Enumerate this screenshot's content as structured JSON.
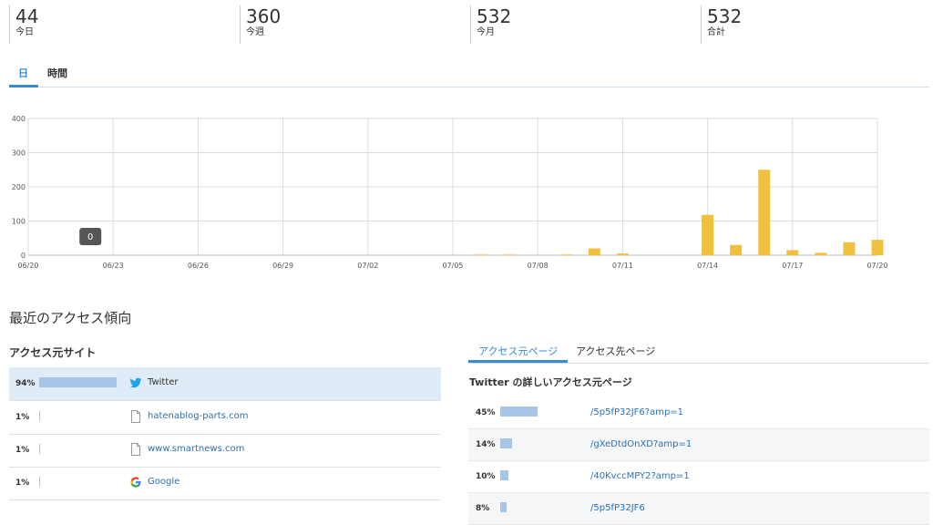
{
  "summary": [
    {
      "value": "44",
      "label": "今日"
    },
    {
      "value": "360",
      "label": "今週"
    },
    {
      "value": "532",
      "label": "今月"
    },
    {
      "value": "532",
      "label": "合計"
    }
  ],
  "view_tabs": [
    {
      "label": "日",
      "active": true
    },
    {
      "label": "時間",
      "active": false
    }
  ],
  "chart_data": {
    "type": "bar",
    "categories": [
      "06/20",
      "06/21",
      "06/22",
      "06/23",
      "06/24",
      "06/25",
      "06/26",
      "06/27",
      "06/28",
      "06/29",
      "06/30",
      "07/01",
      "07/02",
      "07/03",
      "07/04",
      "07/05",
      "07/06",
      "07/07",
      "07/08",
      "07/09",
      "07/10",
      "07/11",
      "07/12",
      "07/13",
      "07/14",
      "07/15",
      "07/16",
      "07/17",
      "07/18",
      "07/19",
      "07/20"
    ],
    "values": [
      0,
      0,
      0,
      0,
      0,
      0,
      0,
      0,
      0,
      0,
      0,
      0,
      0,
      0,
      0,
      0,
      2,
      2,
      0,
      2,
      20,
      5,
      0,
      0,
      118,
      30,
      250,
      15,
      7,
      38,
      45
    ],
    "x_tick_labels": [
      "06/20",
      "06/23",
      "06/26",
      "06/29",
      "07/02",
      "07/05",
      "07/08",
      "07/11",
      "07/14",
      "07/17",
      "07/20"
    ],
    "y_tick_labels": [
      "0",
      "100",
      "200",
      "300",
      "400"
    ],
    "ylim": [
      0,
      400
    ],
    "tooltip": "0",
    "bar_color": "#f0c040",
    "grid": true
  },
  "recent_title": "最近のアクセス傾向",
  "sources": {
    "title": "アクセス元サイト",
    "rows": [
      {
        "pct": "94%",
        "pct_value": 0.94,
        "icon": "twitter-icon",
        "label": "Twitter"
      },
      {
        "pct": "1%",
        "pct_value": 0.01,
        "icon": "document-icon",
        "label": "hatenablog-parts.com"
      },
      {
        "pct": "1%",
        "pct_value": 0.01,
        "icon": "document-icon",
        "label": "www.smartnews.com"
      },
      {
        "pct": "1%",
        "pct_value": 0.01,
        "icon": "google-icon",
        "label": "Google"
      }
    ]
  },
  "page_tabs": [
    {
      "label": "アクセス元ページ",
      "active": true
    },
    {
      "label": "アクセス先ページ",
      "active": false
    }
  ],
  "detail": {
    "title": "Twitter の詳しいアクセス元ページ",
    "rows": [
      {
        "pct": "45%",
        "pct_value": 0.45,
        "link": "/5p5fP32JF6?amp=1"
      },
      {
        "pct": "14%",
        "pct_value": 0.14,
        "link": "/gXeDtdOnXD?amp=1"
      },
      {
        "pct": "10%",
        "pct_value": 0.1,
        "link": "/40KvccMPY2?amp=1"
      },
      {
        "pct": "8%",
        "pct_value": 0.08,
        "link": "/5p5fP32JF6"
      }
    ]
  },
  "colors": {
    "accent": "#3b8ad3",
    "bar": "#f0c040",
    "highlight_row": "#dfebf6",
    "link": "#2a6fb5",
    "twitter": "#1da1f2"
  }
}
